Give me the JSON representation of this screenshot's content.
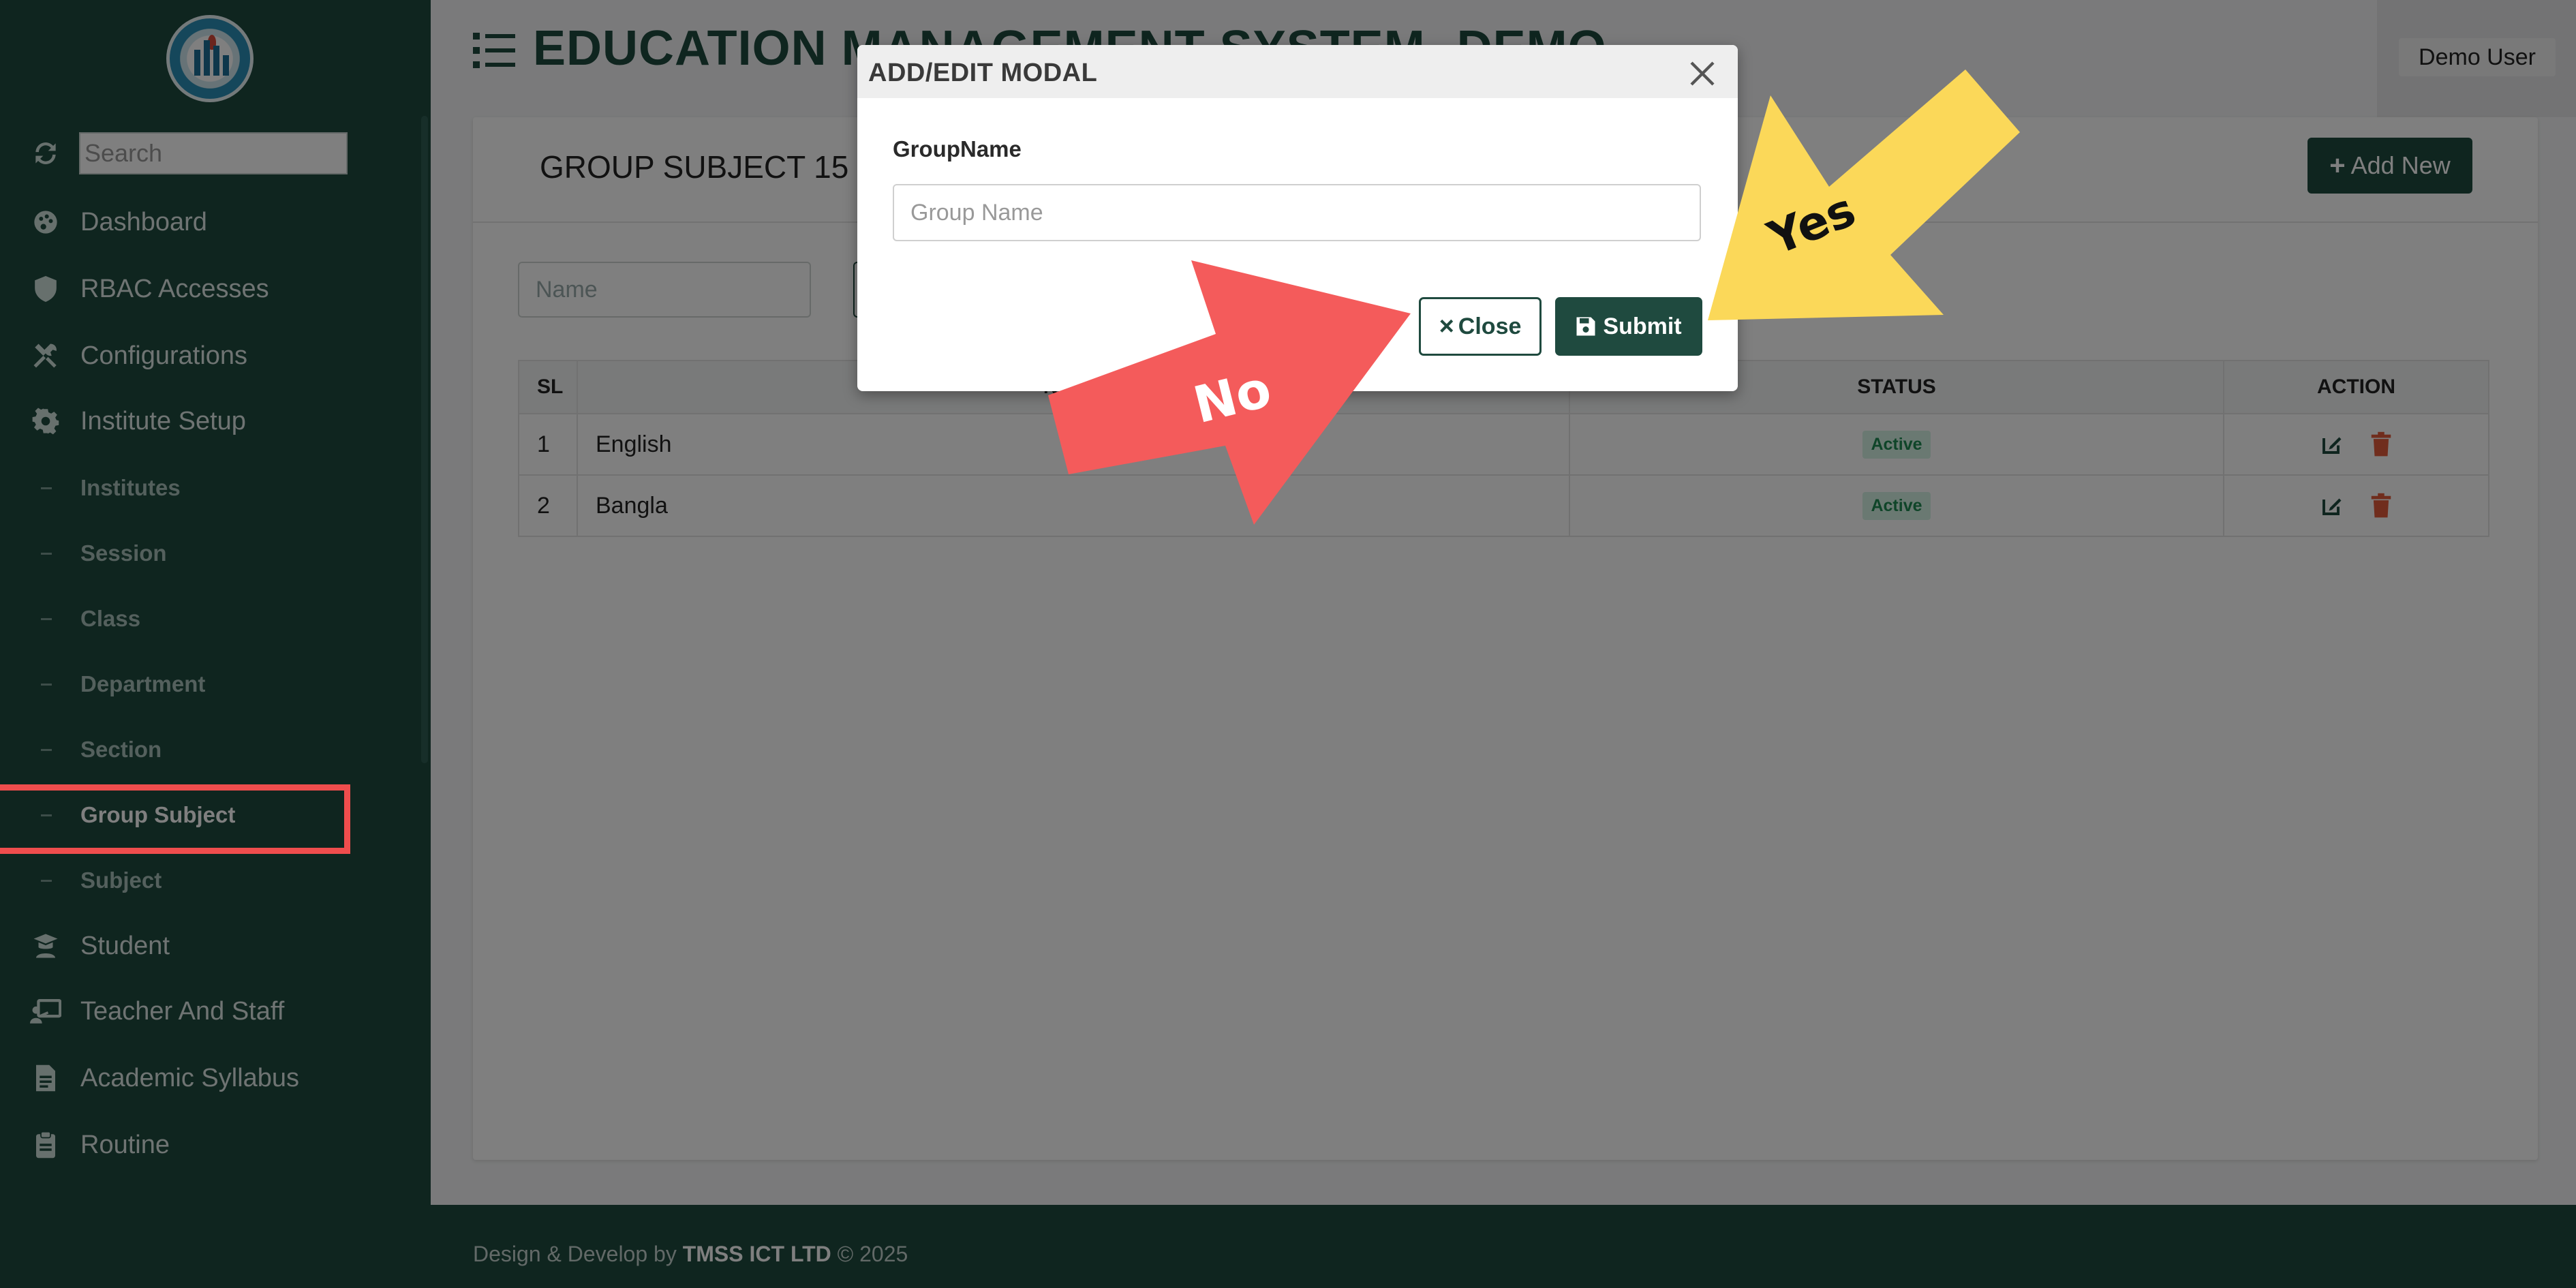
{
  "sidebar": {
    "search_placeholder": "Search",
    "items": [
      {
        "label": "Dashboard",
        "icon": "palette-icon"
      },
      {
        "label": "RBAC Accesses",
        "icon": "shield-icon"
      },
      {
        "label": "Configurations",
        "icon": "tools-icon"
      },
      {
        "label": "Institute Setup",
        "icon": "gear-icon"
      }
    ],
    "subitems": [
      "Institutes",
      "Session",
      "Class",
      "Department",
      "Section",
      "Group Subject",
      "Subject"
    ],
    "active_subitem": "Group Subject",
    "items_after": [
      {
        "label": "Student",
        "icon": "graduate-icon"
      },
      {
        "label": "Teacher And Staff",
        "icon": "chalkboard-teacher-icon"
      },
      {
        "label": "Academic Syllabus",
        "icon": "file-icon"
      },
      {
        "label": "Routine",
        "icon": "clipboard-icon"
      }
    ]
  },
  "header": {
    "title": "EDUCATION MANAGEMENT SYSTEM- DEMO",
    "user": "Demo User"
  },
  "toolbar": {
    "group_select": "GROUP SUBJECT 15",
    "add_new_label": "Add New",
    "name_filter_placeholder": "Name"
  },
  "table": {
    "headers": [
      "SL",
      "NAME",
      "STATUS",
      "ACTION"
    ],
    "rows": [
      {
        "sl": "1",
        "name": "English",
        "status": "Active"
      },
      {
        "sl": "2",
        "name": "Bangla",
        "status": "Active"
      }
    ]
  },
  "modal": {
    "title": "ADD/EDIT MODAL",
    "field_label": "GroupName",
    "field_placeholder": "Group Name",
    "close_label": "Close",
    "submit_label": "Submit"
  },
  "annotations": {
    "no_label": "No",
    "yes_label": "Yes"
  },
  "footer": {
    "prefix": "Design & Develop by ",
    "company": "TMSS ICT LTD",
    "suffix": " © 2025"
  },
  "colors": {
    "brand": "#1f4a3f",
    "highlight": "#ef4d4d",
    "no_arrow": "#f45b5b",
    "yes_arrow": "#fbd859",
    "active_badge": "#d4f3e4"
  }
}
